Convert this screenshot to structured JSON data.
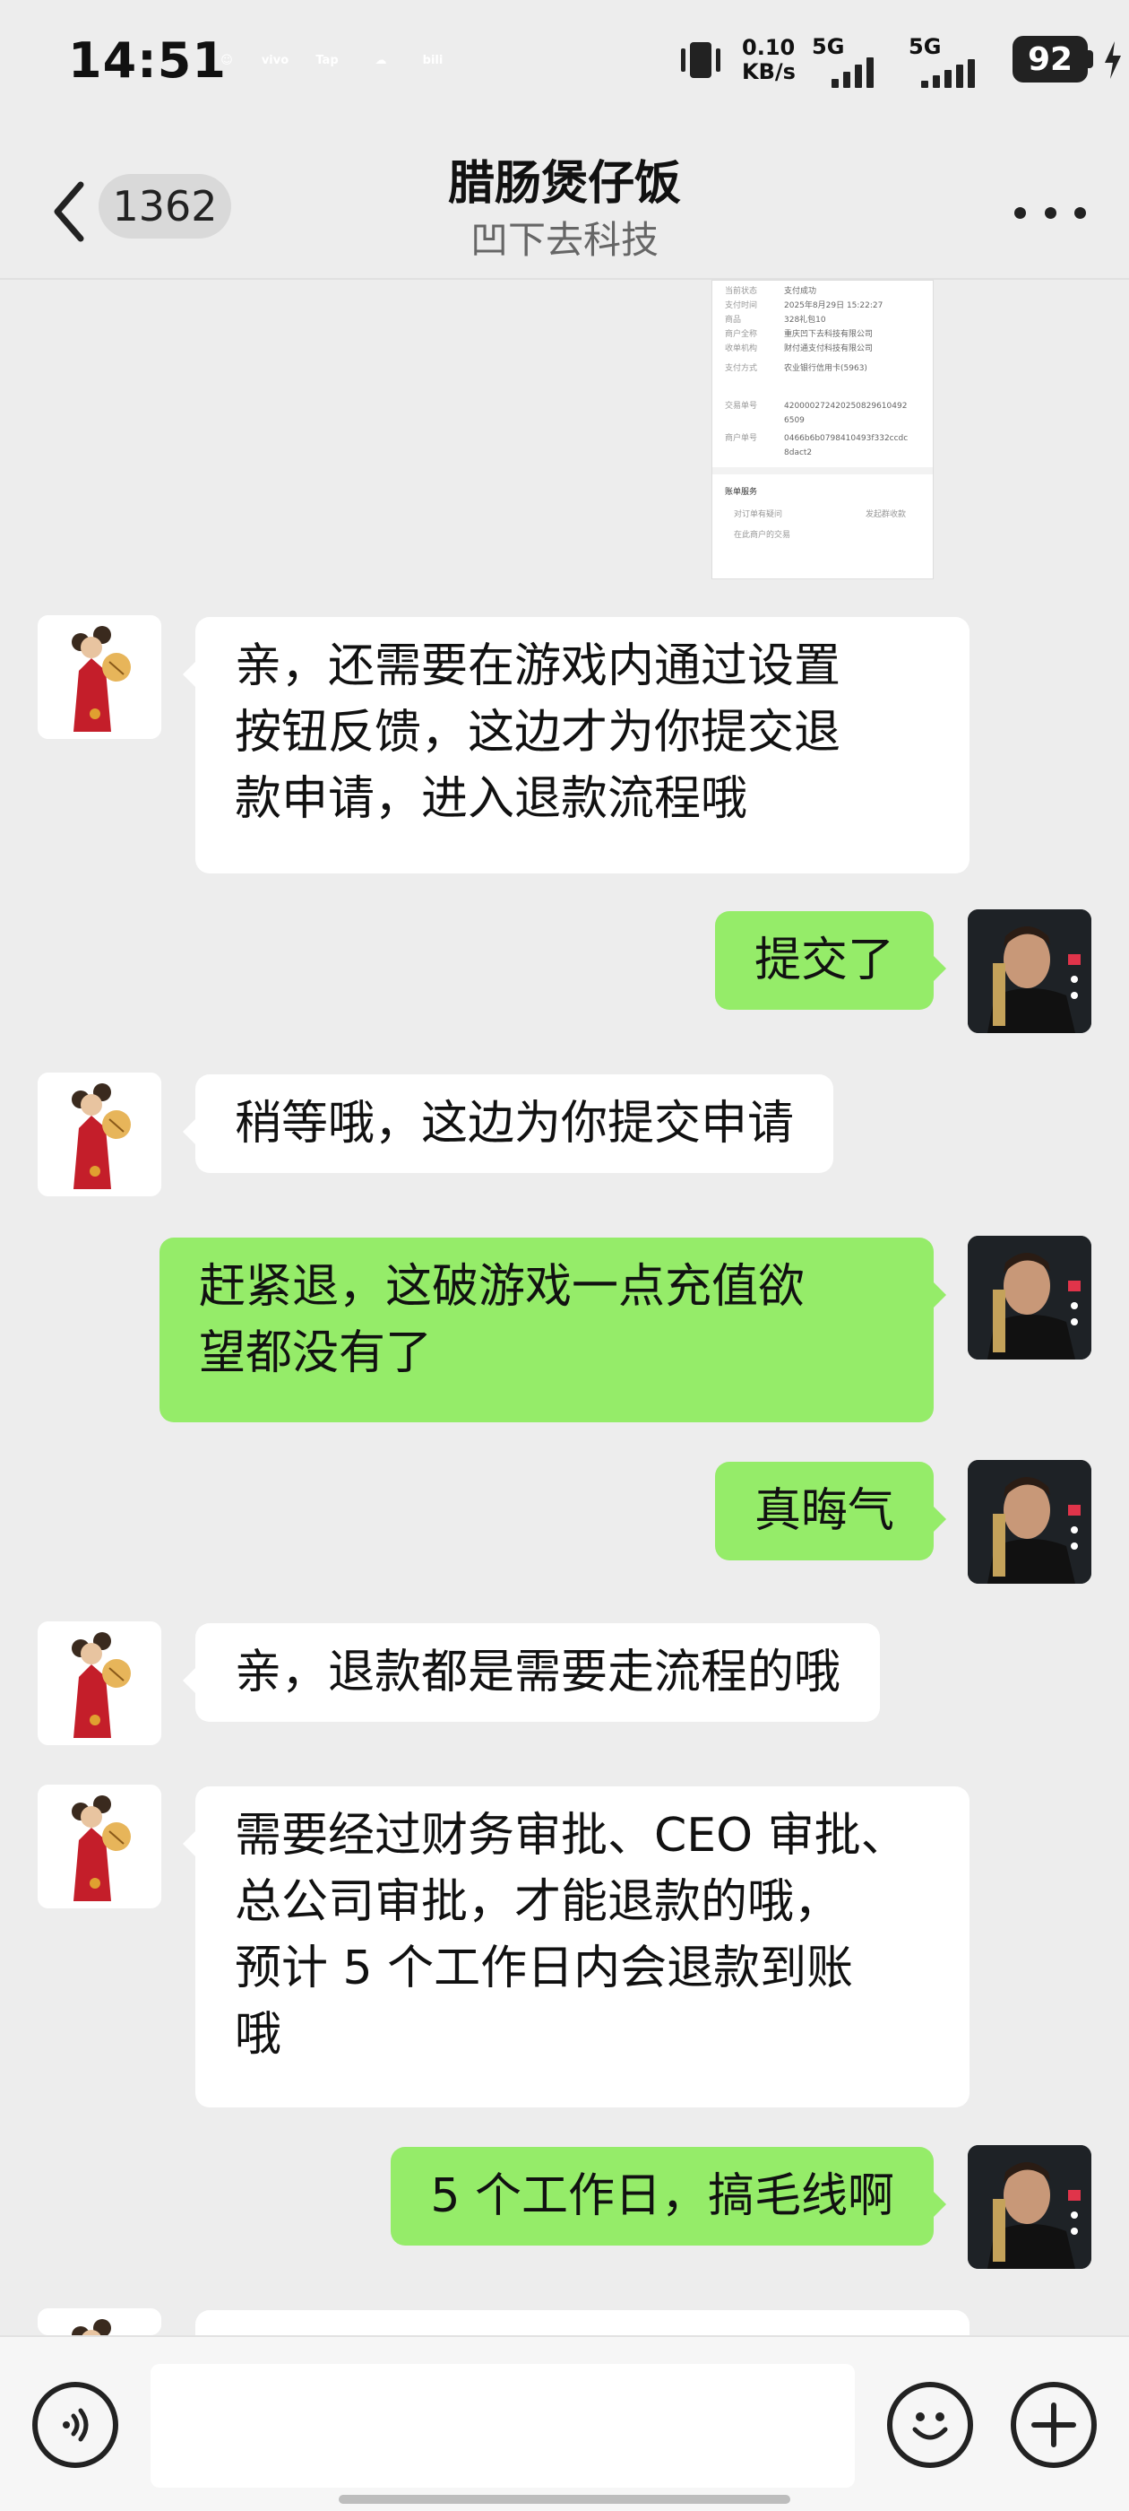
{
  "status_bar": {
    "time": "14:51",
    "apps": [
      {
        "name": "smiley-app-icon",
        "label": "☺",
        "color": "#f8c92c"
      },
      {
        "name": "vivo-app-icon",
        "label": "vivo",
        "color": "#415fff"
      },
      {
        "name": "tap-app-icon",
        "label": "Tap",
        "color": "#14c5cc"
      },
      {
        "name": "cloud-app-icon",
        "label": "☁",
        "color": "#2f86f6"
      },
      {
        "name": "bilibili-app-icon",
        "label": "bili",
        "color": "#f25d8e"
      }
    ],
    "net_speed": "0.10",
    "net_unit": "KB/s",
    "sim1": "5G",
    "sim2": "5G",
    "battery": "92"
  },
  "header": {
    "unread_count": "1362",
    "title": "腊肠煲仔饭",
    "subtitle": "凹下去科技"
  },
  "receipt": {
    "rows": [
      {
        "label": "当前状态",
        "value": "支付成功"
      },
      {
        "label": "支付时间",
        "value": "2025年8月29日 15:22:27"
      },
      {
        "label": "商品",
        "value": "328礼包10"
      },
      {
        "label": "商户全称",
        "value": "重庆凹下去科技有限公司"
      },
      {
        "label": "收单机构",
        "value": "财付通支付科技有限公司"
      },
      {
        "label": "支付方式",
        "value": "农业银行信用卡(5963)"
      },
      {
        "label": "交易单号",
        "value": "4200002724202508296104926509"
      },
      {
        "label": "商户单号",
        "value": "0466b6b0798410493f332ccdc8dact2"
      }
    ],
    "footer_title": "账单服务",
    "footer_items": [
      "对订单有疑问",
      "发起群收款",
      "在此商户的交易"
    ]
  },
  "messages": [
    {
      "from": "them",
      "text": "亲，还需要在游戏内通过设置\n按钮反馈，这边才为你提交退\n款申请，进入退款流程哦"
    },
    {
      "from": "me",
      "text": "提交了"
    },
    {
      "from": "them",
      "text": "稍等哦，这边为你提交申请"
    },
    {
      "from": "me",
      "text": "赶紧退，这破游戏一点充值欲\n望都没有了"
    },
    {
      "from": "me",
      "text": "真晦气"
    },
    {
      "from": "them",
      "text": "亲，退款都是需要走流程的哦"
    },
    {
      "from": "them",
      "text": "需要经过财务审批、CEO 审批、\n总公司审批，才能退款的哦，\n预计 5 个工作日内会退款到账\n哦"
    },
    {
      "from": "me",
      "text": "5 个工作日，搞毛线啊"
    }
  ],
  "input_bar": {
    "voice_icon": "voice-icon",
    "emoji_icon": "emoji-icon",
    "plus_icon": "plus-icon",
    "placeholder": ""
  },
  "colors": {
    "background": "#ededed",
    "my_bubble": "#95ec69",
    "their_bubble": "#ffffff"
  }
}
